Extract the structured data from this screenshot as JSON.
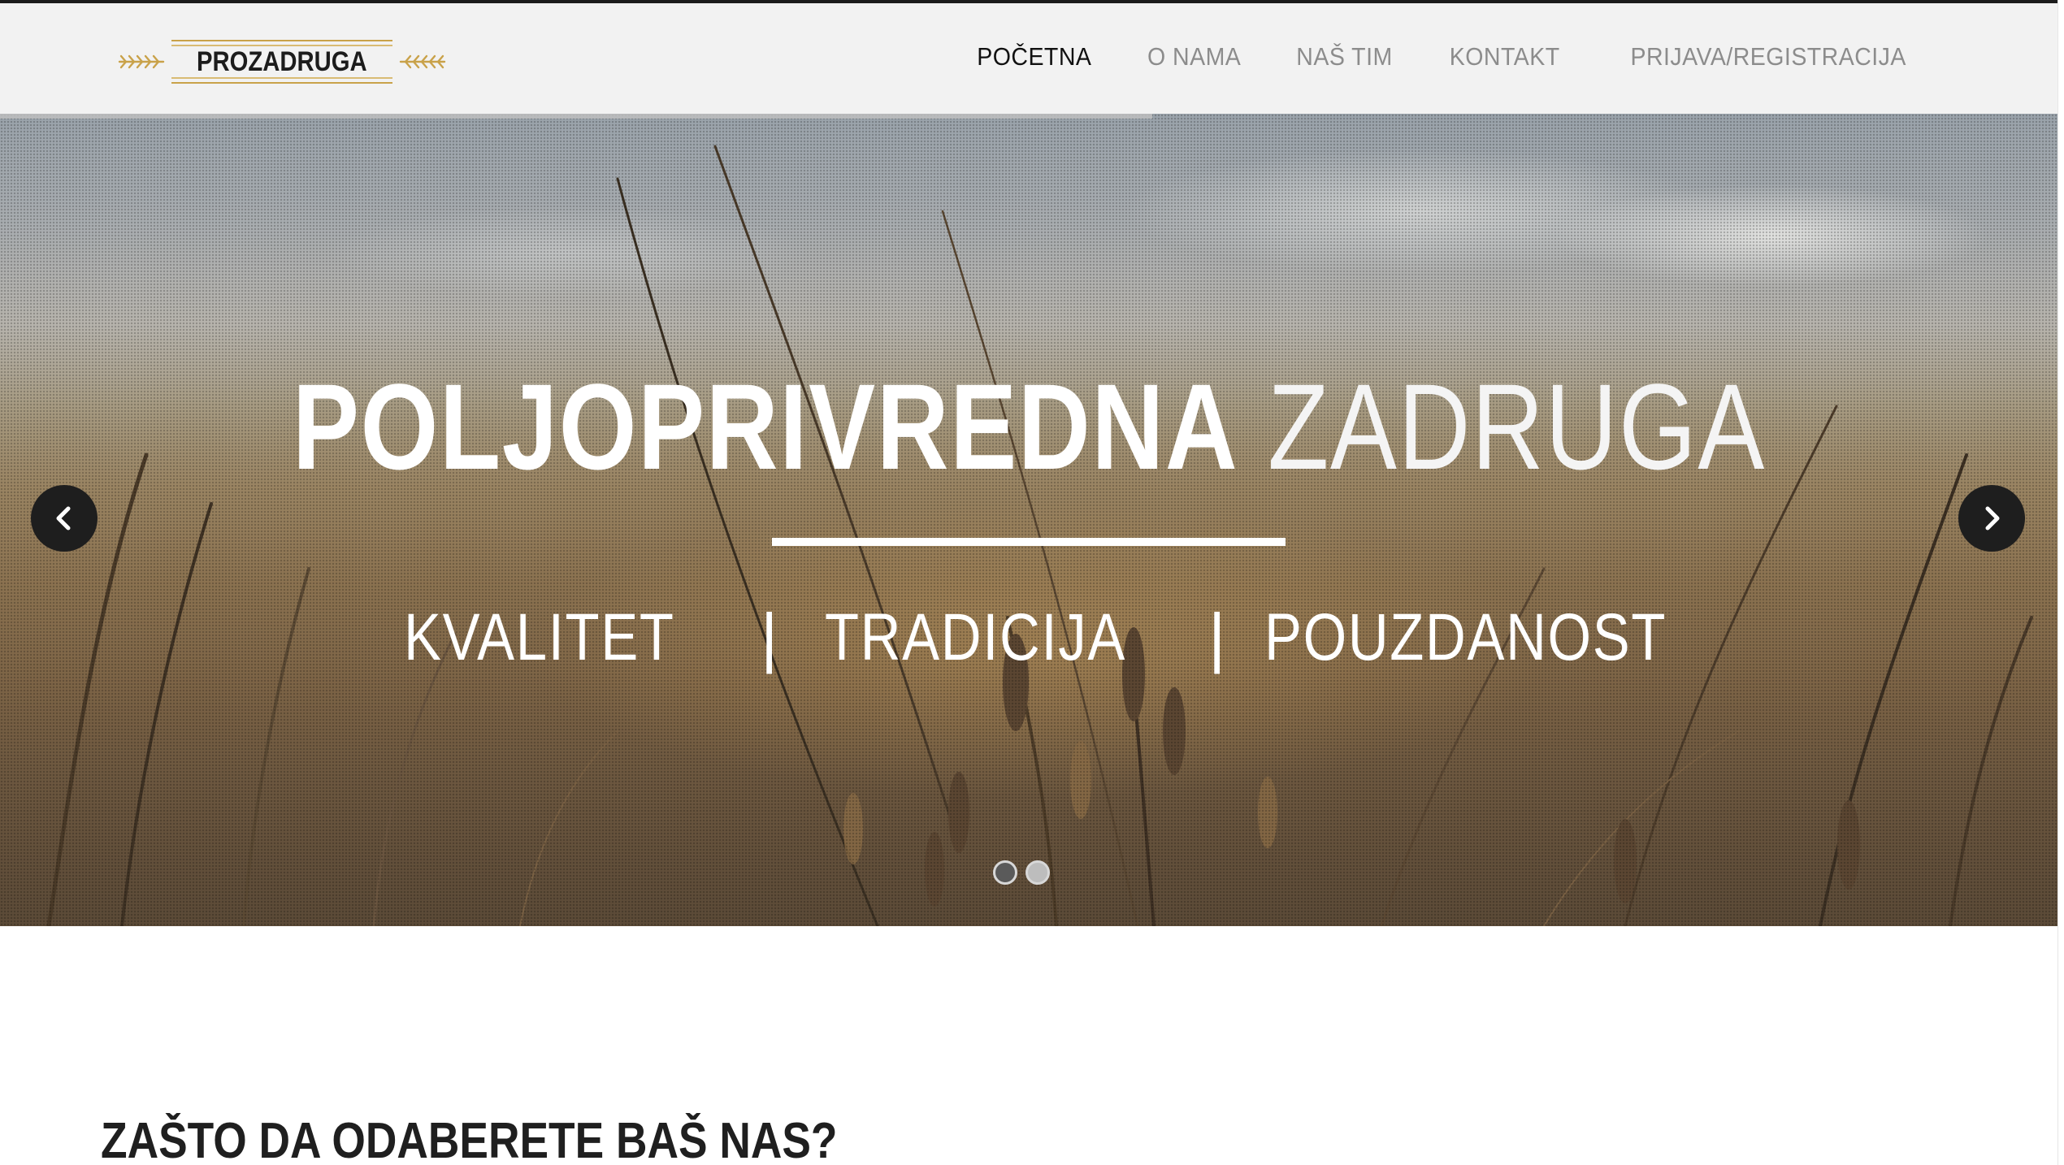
{
  "header": {
    "logo_text": "PROZADRUGA",
    "nav": [
      {
        "label": "POČETNA",
        "active": true
      },
      {
        "label": "O NAMA",
        "active": false
      },
      {
        "label": "NAŠ TIM",
        "active": false
      },
      {
        "label": "KONTAKT",
        "active": false
      },
      {
        "label": "PRIJAVA/REGISTRACIJA",
        "active": false
      }
    ]
  },
  "hero": {
    "title_bold": "POLJOPRIVREDNA",
    "title_light": "ZADRUGA",
    "tags": [
      "KVALITET",
      "TRADICIJA",
      "POUZDANOST"
    ],
    "separator": "|",
    "prev_icon": "chevron-left-icon",
    "next_icon": "chevron-right-icon",
    "slides_total": 2,
    "slide_active": 1,
    "slide_progress": 0.56
  },
  "content": {
    "section_title": "ZAŠTO DA ODABERETE BAŠ NAS?"
  },
  "colors": {
    "header_bg": "#f2f2f2",
    "nav_active": "#111111",
    "nav_inactive": "#8c8c8c",
    "logo_gold": "#c9a24a",
    "hero_text": "#ffffff",
    "arrow_bg": "#1e1e1e"
  }
}
